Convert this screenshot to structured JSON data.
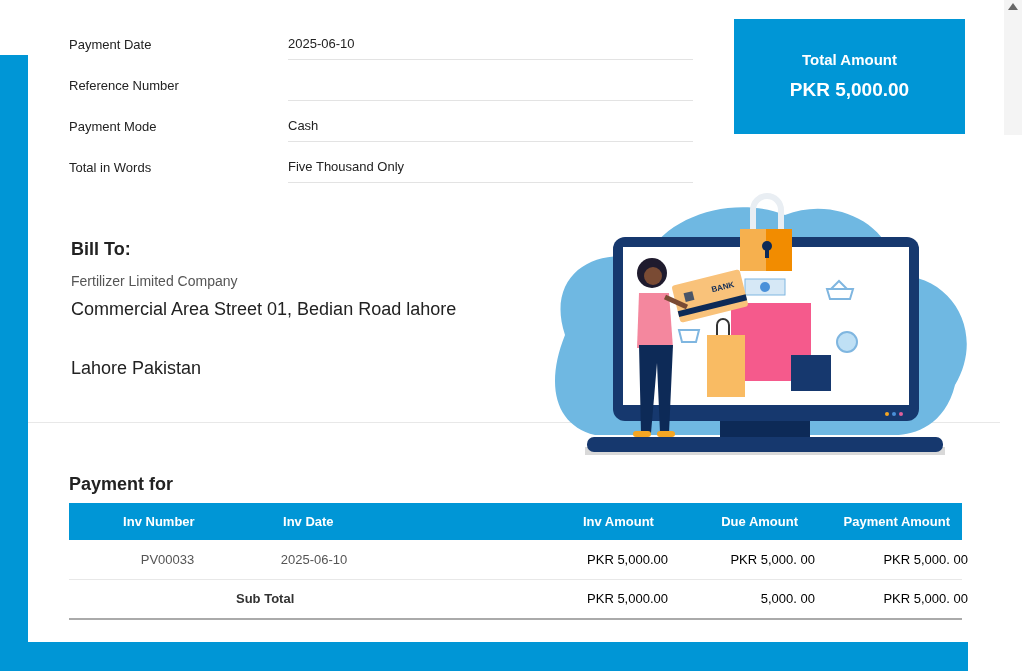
{
  "fields": [
    {
      "label": "Payment Date",
      "value": "2025-06-10"
    },
    {
      "label": "Reference Number"
    },
    {
      "label": "Payment Mode",
      "value": "Cash"
    },
    {
      "label": "Total in Words",
      "value": "Five Thousand Only"
    }
  ],
  "total": {
    "label": "Total Amount",
    "value": "PKR 5,000.00"
  },
  "bill_to": {
    "heading": "Bill To:",
    "company": "Fertilizer Limited Company",
    "address": "Commercial Area Street 01, Bedian Road lahore",
    "city": "Lahore Pakistan"
  },
  "illustration": {
    "card_text": "BANK"
  },
  "payment_for": {
    "heading": "Payment for",
    "columns": [
      "Inv Number",
      "Inv Date",
      "Inv Amount",
      "Due Amount",
      "Payment Amount"
    ],
    "rows": [
      {
        "kind": "item",
        "cells": [
          "PV00033",
          "2025-06-10",
          "PKR 5,000.00",
          "PKR 5,000. 00",
          "PKR 5,000. 00"
        ]
      },
      {
        "kind": "subtotal",
        "cells": [
          "",
          "Sub Total",
          "PKR 5,000.00",
          "5,000. 00",
          "PKR 5,000. 00"
        ]
      }
    ]
  }
}
